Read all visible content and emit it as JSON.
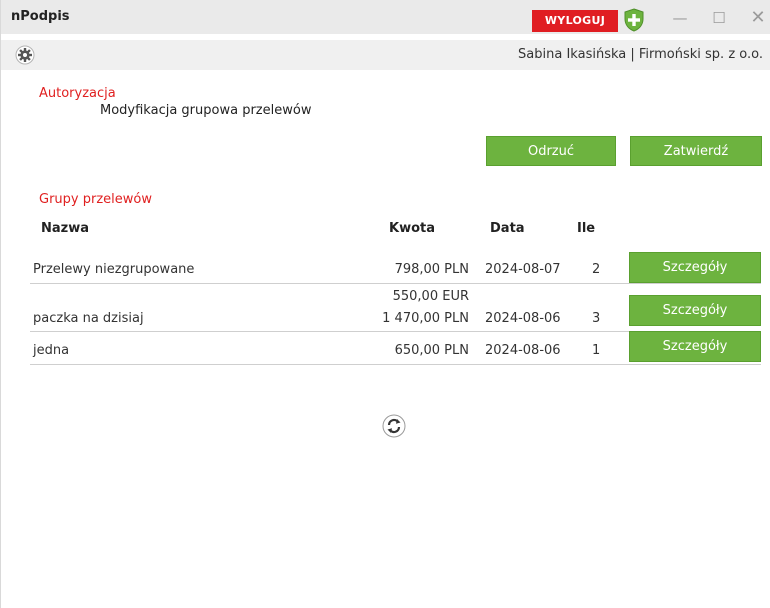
{
  "window": {
    "title": "nPodpis",
    "logout_label": "WYLOGUJ",
    "minimize_glyph": "—",
    "maximize_glyph": "☐",
    "close_glyph": "✕",
    "shield_icon": "shield-icon",
    "colors": {
      "logout": "#e01d22",
      "accent_green": "#6db33f",
      "section_red": "#e02020"
    }
  },
  "userbar": {
    "settings_icon": "gear-icon",
    "user_info": "Sabina Ikasińska  |  Firmoński sp. z o.o."
  },
  "authorization": {
    "title": "Autoryzacja",
    "subtitle": "Modyfikacja grupowa przelewów",
    "reject_label": "Odrzuć",
    "accept_label": "Zatwierdź"
  },
  "groups": {
    "title": "Grupy przelewów",
    "headers": {
      "name": "Nazwa",
      "amount": "Kwota",
      "date": "Data",
      "count": "Ile"
    },
    "rows": [
      {
        "name": "Przelewy niezgrupowane",
        "amount_lines": [
          "798,00 PLN"
        ],
        "date": "2024-08-07",
        "count": "2",
        "details_label": "Szczegóły"
      },
      {
        "name": "paczka na dzisiaj",
        "amount_lines": [
          "550,00 EUR",
          "1 470,00 PLN"
        ],
        "date": "2024-08-06",
        "count": "3",
        "details_label": "Szczegóły"
      },
      {
        "name": "jedna",
        "amount_lines": [
          "650,00 PLN"
        ],
        "date": "2024-08-06",
        "count": "1",
        "details_label": "Szczegóły"
      }
    ]
  },
  "refresh_icon": "refresh-icon"
}
